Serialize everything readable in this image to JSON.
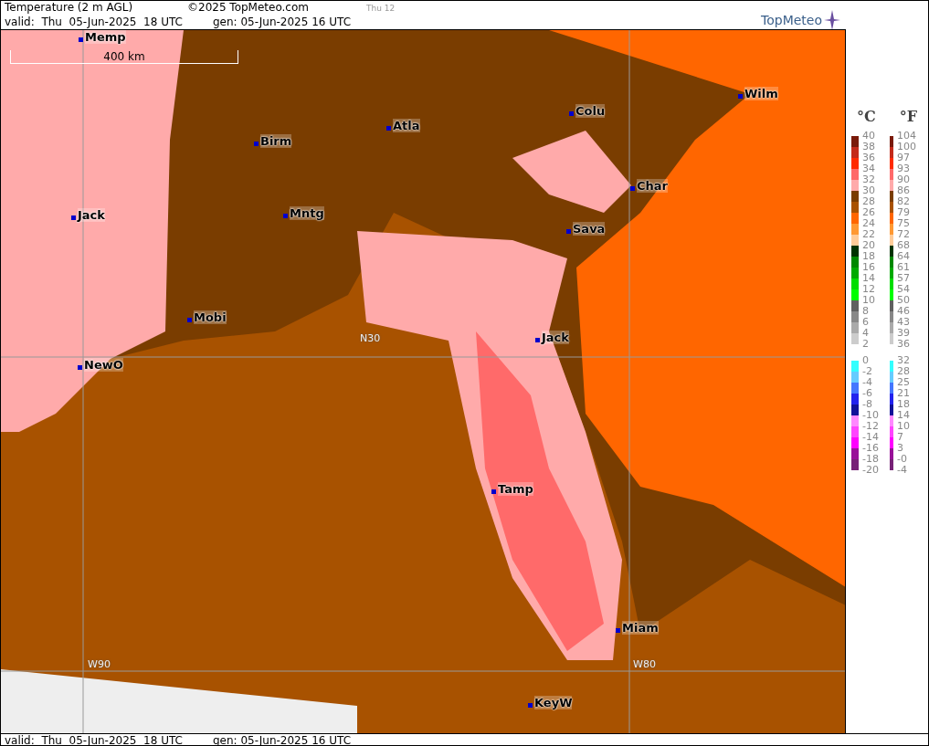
{
  "header": {
    "title": "Temperature (2 m AGL)",
    "copyright": "©2025 TopMeteo.com",
    "run": "Thu 12",
    "valid": "valid:  Thu  05-Jun-2025  18 UTC",
    "generated": "gen: 05-Jun-2025 16 UTC",
    "logo": "TopMeteo"
  },
  "footer": {
    "valid": "valid:  Thu  05-Jun-2025  18 UTC",
    "generated": "gen: 05-Jun-2025 16 UTC"
  },
  "map": {
    "scale": "400 km",
    "grid": [
      {
        "kind": "meridian",
        "label": "W90"
      },
      {
        "kind": "meridian",
        "label": "W80"
      },
      {
        "kind": "parallel",
        "label": "N30"
      }
    ],
    "cities": [
      {
        "name": "Memp"
      },
      {
        "name": "Wilm"
      },
      {
        "name": "Colu"
      },
      {
        "name": "Atla"
      },
      {
        "name": "Birm"
      },
      {
        "name": "Char"
      },
      {
        "name": "Jack"
      },
      {
        "name": "Mntg"
      },
      {
        "name": "Sava"
      },
      {
        "name": "Mobi"
      },
      {
        "name": "Jack"
      },
      {
        "name": "NewO"
      },
      {
        "name": "Tamp"
      },
      {
        "name": "Miam"
      },
      {
        "name": "KeyW"
      }
    ]
  },
  "legend": {
    "celsius_unit": "°C",
    "fahrenheit_unit": "°F",
    "groups": [
      {
        "labels": [
          {
            "c": "40",
            "f": "104"
          },
          {
            "c": "38",
            "f": "100"
          },
          {
            "c": "36",
            "f": "97"
          },
          {
            "c": "34",
            "f": "93"
          },
          {
            "c": "32",
            "f": "90"
          },
          {
            "c": "30",
            "f": "86"
          },
          {
            "c": "28",
            "f": "82"
          },
          {
            "c": "26",
            "f": "79"
          },
          {
            "c": "24",
            "f": "75"
          },
          {
            "c": "22",
            "f": "72"
          },
          {
            "c": "20",
            "f": "68"
          },
          {
            "c": "18",
            "f": "64"
          },
          {
            "c": "16",
            "f": "61"
          },
          {
            "c": "14",
            "f": "57"
          },
          {
            "c": "12",
            "f": "54"
          },
          {
            "c": "10",
            "f": "50"
          },
          {
            "c": "8",
            "f": "46"
          },
          {
            "c": "6",
            "f": "43"
          },
          {
            "c": "4",
            "f": "39"
          },
          {
            "c": "2",
            "f": "36"
          }
        ],
        "bands": [
          {
            "color": "#7a1a0a"
          },
          {
            "color": "#c42a1a"
          },
          {
            "color": "#ff2a00"
          },
          {
            "color": "#ff6a6a"
          },
          {
            "color": "#ffaaaa"
          },
          {
            "color": "#7a3d00"
          },
          {
            "color": "#a85200"
          },
          {
            "color": "#ff6600"
          },
          {
            "color": "#ff9933"
          },
          {
            "color": "#ffcc99"
          },
          {
            "color": "#003300"
          },
          {
            "color": "#008800"
          },
          {
            "color": "#00aa00"
          },
          {
            "color": "#00dd00"
          },
          {
            "color": "#00ff00"
          },
          {
            "color": "#606060"
          },
          {
            "color": "#888888"
          },
          {
            "color": "#aaaaaa"
          },
          {
            "color": "#cccccc"
          }
        ]
      },
      {
        "labels": [
          {
            "c": "0",
            "f": "32"
          },
          {
            "c": "-2",
            "f": "28"
          },
          {
            "c": "-4",
            "f": "25"
          },
          {
            "c": "-6",
            "f": "21"
          },
          {
            "c": "-8",
            "f": "18"
          },
          {
            "c": "-10",
            "f": "14"
          },
          {
            "c": "-12",
            "f": "10"
          },
          {
            "c": "-14",
            "f": "7"
          },
          {
            "c": "-16",
            "f": "3"
          },
          {
            "c": "-18",
            "f": "-0"
          },
          {
            "c": "-20",
            "f": "-4"
          }
        ],
        "bands": [
          {
            "color": "#33ffff"
          },
          {
            "color": "#66ccff"
          },
          {
            "color": "#4477ff"
          },
          {
            "color": "#2222ee"
          },
          {
            "color": "#111199"
          },
          {
            "color": "#ff88ff"
          },
          {
            "color": "#ff44ff"
          },
          {
            "color": "#ff00ff"
          },
          {
            "color": "#991199"
          },
          {
            "color": "#772277"
          }
        ]
      }
    ]
  }
}
